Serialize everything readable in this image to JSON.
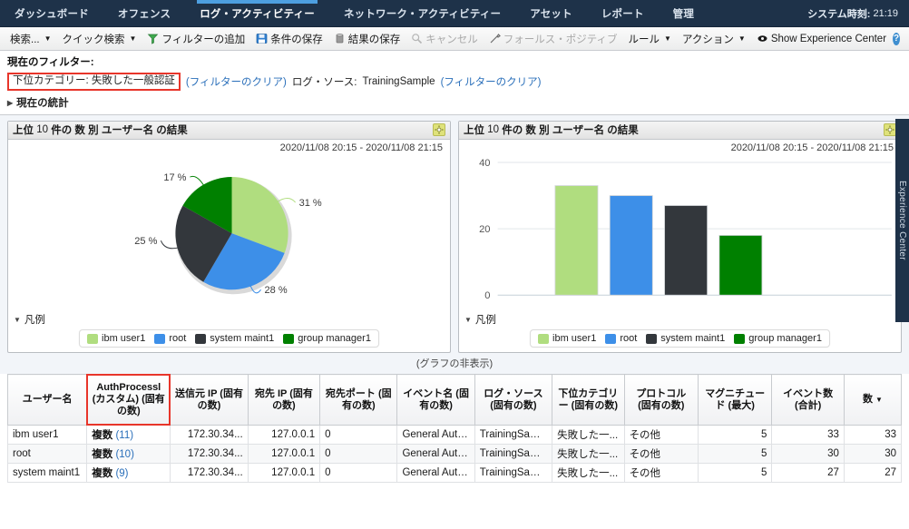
{
  "nav": {
    "items": [
      {
        "label": "ダッシュボード",
        "name": "nav-dashboard",
        "active": false
      },
      {
        "label": "オフェンス",
        "name": "nav-offenses",
        "active": false
      },
      {
        "label": "ログ・アクティビティー",
        "name": "nav-log-activity",
        "active": true
      },
      {
        "label": "ネットワーク・アクティビティー",
        "name": "nav-network-activity",
        "active": false
      },
      {
        "label": "アセット",
        "name": "nav-assets",
        "active": false
      },
      {
        "label": "レポート",
        "name": "nav-reports",
        "active": false
      },
      {
        "label": "管理",
        "name": "nav-admin",
        "active": false
      }
    ],
    "system_time_label": "システム時刻:",
    "system_time_value": "21:19"
  },
  "toolbar": {
    "search": "検索...",
    "quick_search": "クイック検索",
    "add_filter": "フィルターの追加",
    "save_criteria": "条件の保存",
    "save_results": "結果の保存",
    "cancel": "キャンセル",
    "false_positive": "フォールス・ポジティブ",
    "rules": "ルール",
    "actions": "アクション",
    "show_experience_center": "Show Experience Center",
    "help": "?"
  },
  "filter": {
    "title": "現在のフィルター:",
    "chip_label": "下位カテゴリー: 失敗した一般認証",
    "clear_1": "(フィルターのクリア)",
    "logsource_label": "ログ・ソース:",
    "logsource_value": "TrainingSample",
    "clear_2": "(フィルターのクリア)",
    "current_stats": "現在の統計"
  },
  "panels": {
    "left": {
      "title_prefix": "上位",
      "title_count": "10",
      "title_mid": "件の",
      "title_metric": "数",
      "title_by": "別",
      "title_field": "ユーザー名",
      "title_suffix": "の結果",
      "date_range": "2020/11/08 20:15 - 2020/11/08 21:15",
      "legend_toggle": "凡例"
    },
    "right": {
      "title_prefix": "上位",
      "title_count": "10",
      "title_mid": "件の",
      "title_metric": "数",
      "title_by": "別",
      "title_field": "ユーザー名",
      "title_suffix": "の結果",
      "date_range": "2020/11/08 20:15 - 2020/11/08 21:15",
      "legend_toggle": "凡例"
    }
  },
  "hide_chart": "(グラフの非表示)",
  "experience_center_rail": "Experience Center",
  "colors": {
    "ibm_user1": "#b0dd7f",
    "root": "#3d8fe8",
    "system_maint1": "#33373c",
    "group_manager1": "#008000",
    "nav_bg": "#1e3249",
    "accent_link": "#2a6fba",
    "highlight_red": "#e8352a"
  },
  "chart_data": [
    {
      "type": "pie",
      "title": "上位 10 件の 数 別 ユーザー名 の結果",
      "subtitle": "2020/11/08 20:15 - 2020/11/08 21:15",
      "categories": [
        "ibm user1",
        "root",
        "system maint1",
        "group manager1"
      ],
      "values": [
        31,
        28,
        25,
        17
      ],
      "value_labels": [
        "31 %",
        "28 %",
        "25 %",
        "17 %"
      ],
      "colors": [
        "#b0dd7f",
        "#3d8fe8",
        "#33373c",
        "#008000"
      ],
      "legend": [
        "ibm user1",
        "root",
        "system maint1",
        "group manager1"
      ],
      "legend_position": "bottom",
      "unit": "%"
    },
    {
      "type": "bar",
      "title": "上位 10 件の 数 別 ユーザー名 の結果",
      "subtitle": "2020/11/08 20:15 - 2020/11/08 21:15",
      "categories": [
        "ibm user1",
        "root",
        "system maint1",
        "group manager1"
      ],
      "values": [
        33,
        30,
        27,
        18
      ],
      "colors": [
        "#b0dd7f",
        "#3d8fe8",
        "#33373c",
        "#008000"
      ],
      "ylim": [
        0,
        40
      ],
      "yticks": [
        "0",
        "20",
        "40"
      ],
      "xlabel": "",
      "ylabel": "",
      "grid": true,
      "legend": [
        "ibm user1",
        "root",
        "system maint1",
        "group manager1"
      ],
      "legend_position": "bottom"
    }
  ],
  "table": {
    "columns": [
      {
        "header": "ユーザー名",
        "name": "col-username",
        "highlight": false,
        "align": "left",
        "width": "9.0%"
      },
      {
        "header": "AuthProcessl (カスタム) (固有の数)",
        "name": "col-authprocess",
        "highlight": true,
        "align": "left",
        "width": "9.5%"
      },
      {
        "header": "送信元 IP (固有の数)",
        "name": "col-source-ip",
        "highlight": false,
        "align": "right",
        "width": "8.8%"
      },
      {
        "header": "宛先 IP (固有の数)",
        "name": "col-dest-ip",
        "highlight": false,
        "align": "right",
        "width": "8.2%"
      },
      {
        "header": "宛先ポート (固有の数)",
        "name": "col-dest-port",
        "highlight": false,
        "align": "left",
        "width": "8.8%"
      },
      {
        "header": "イベント名 (固有の数)",
        "name": "col-event-name",
        "highlight": false,
        "align": "left",
        "width": "8.8%"
      },
      {
        "header": "ログ・ソース (固有の数)",
        "name": "col-log-source",
        "highlight": false,
        "align": "left",
        "width": "8.8%"
      },
      {
        "header": "下位カテゴリー (固有の数)",
        "name": "col-subcategory",
        "highlight": false,
        "align": "left",
        "width": "8.2%"
      },
      {
        "header": "プロトコル (固有の数)",
        "name": "col-protocol",
        "highlight": false,
        "align": "left",
        "width": "8.4%"
      },
      {
        "header": "マグニチュード (最大)",
        "name": "col-magnitude",
        "highlight": false,
        "align": "right",
        "width": "8.4%"
      },
      {
        "header": "イベント数 (合計)",
        "name": "col-event-count",
        "highlight": false,
        "align": "right",
        "width": "8.2%"
      },
      {
        "header": "数",
        "name": "col-count",
        "highlight": false,
        "align": "right",
        "width": "6.5%",
        "sorted": true,
        "sort_caret": "▼"
      }
    ],
    "rows": [
      {
        "username": "ibm user1",
        "authprocess_label": "複数",
        "authprocess_count": "(11)",
        "source_ip": "172.30.34...",
        "dest_ip": "127.0.0.1",
        "dest_port": "0",
        "event_name": "General Auth...",
        "log_source": "TrainingSample",
        "subcategory": "失敗した一...",
        "protocol": "その他",
        "magnitude": "5",
        "event_count": "33",
        "count": "33"
      },
      {
        "username": "root",
        "authprocess_label": "複数",
        "authprocess_count": "(10)",
        "source_ip": "172.30.34...",
        "dest_ip": "127.0.0.1",
        "dest_port": "0",
        "event_name": "General Auth...",
        "log_source": "TrainingSample",
        "subcategory": "失敗した一...",
        "protocol": "その他",
        "magnitude": "5",
        "event_count": "30",
        "count": "30"
      },
      {
        "username": "system maint1",
        "authprocess_label": "複数",
        "authprocess_count": "(9)",
        "source_ip": "172.30.34...",
        "dest_ip": "127.0.0.1",
        "dest_port": "0",
        "event_name": "General Auth...",
        "log_source": "TrainingSample",
        "subcategory": "失敗した一...",
        "protocol": "その他",
        "magnitude": "5",
        "event_count": "27",
        "count": "27"
      }
    ]
  }
}
